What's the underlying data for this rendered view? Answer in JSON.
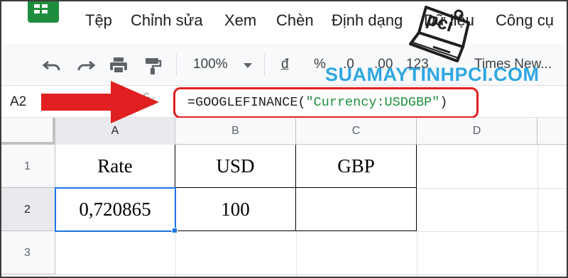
{
  "menu": {
    "items": [
      "Tệp",
      "Chỉnh sửa",
      "Xem",
      "Chèn",
      "Định dạng",
      "Dữ liệu",
      "Công cụ"
    ]
  },
  "toolbar": {
    "zoom": "100%",
    "currency": "đ",
    "percent": "%",
    "decrease_decimal": ".0",
    "increase_decimal": ".00",
    "more_formats": "123",
    "font": "Times New..."
  },
  "formula_bar": {
    "cell_ref": "A2",
    "fx": "fx",
    "formula_prefix": "=GOOGLEFINANCE(",
    "formula_string": "\"Currency:USDGBP\"",
    "formula_suffix": ")"
  },
  "watermark": {
    "text": "SUAMAYTINHPCI.COM"
  },
  "sheet": {
    "columns": [
      "A",
      "B",
      "C",
      "D"
    ],
    "rows": [
      "1",
      "2",
      "3"
    ],
    "cells": {
      "a1": "Rate",
      "b1": "USD",
      "c1": "GBP",
      "a2": "0,720865",
      "b2": "100",
      "c2": ""
    },
    "selected_cell": "A2"
  },
  "colors": {
    "accent": "#1a73e8",
    "logo_green": "#1e8e3e",
    "annotation_red": "#e02020",
    "watermark_blue": "#1ea1e0"
  }
}
